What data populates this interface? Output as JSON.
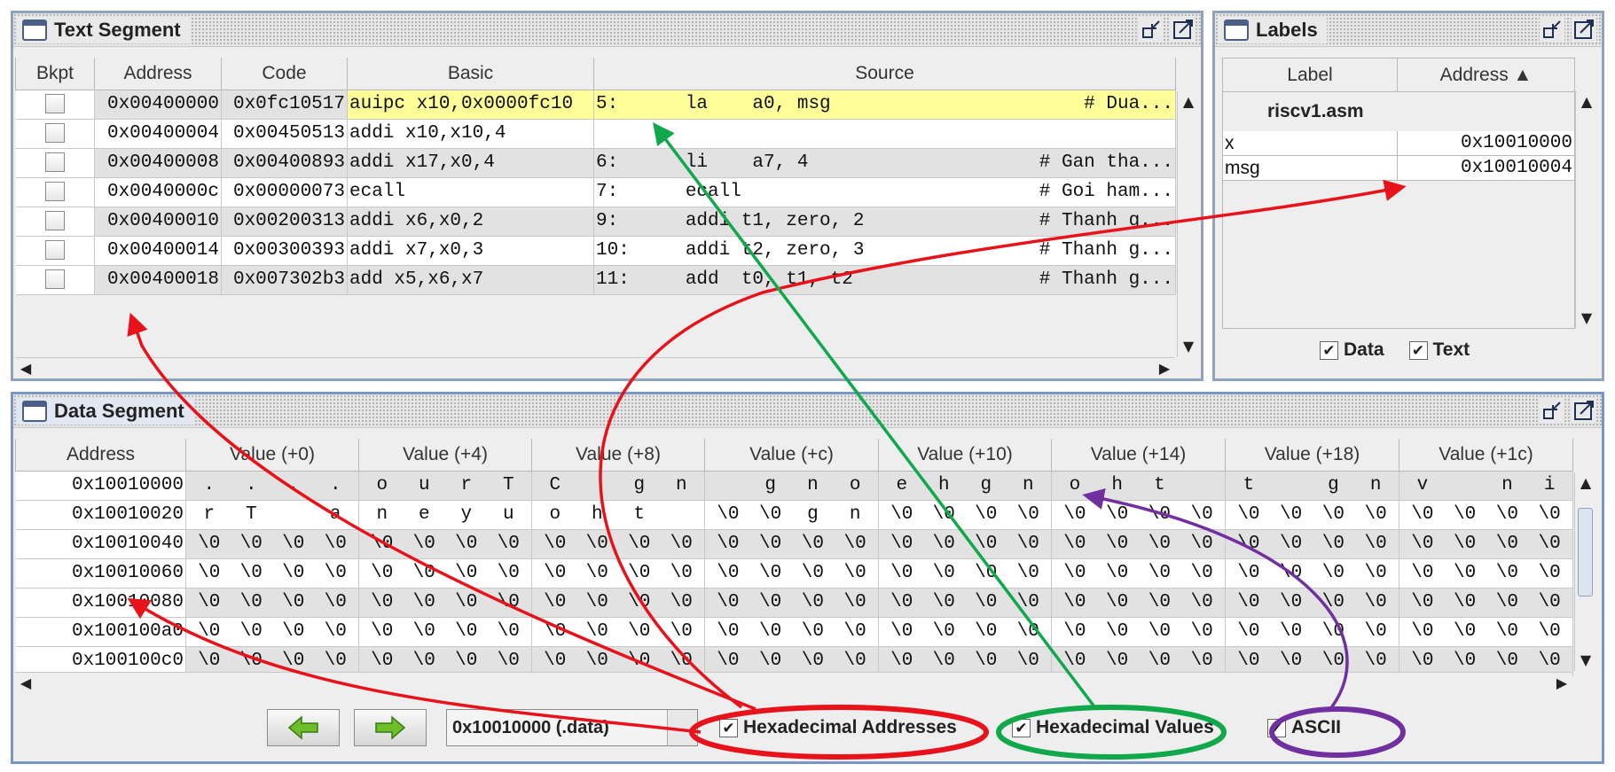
{
  "text_segment": {
    "title": "Text Segment",
    "columns": [
      "Bkpt",
      "Address",
      "Code",
      "Basic",
      "Source"
    ],
    "rows": [
      {
        "address": "0x00400000",
        "code": "0x0fc10517",
        "basic": "auipc x10,0x0000fc10",
        "source": "5:      la    a0, msg",
        "comment": "# Dua...",
        "highlight": true
      },
      {
        "address": "0x00400004",
        "code": "0x00450513",
        "basic": "addi x10,x10,4",
        "source": "",
        "comment": ""
      },
      {
        "address": "0x00400008",
        "code": "0x00400893",
        "basic": "addi x17,x0,4",
        "source": "6:      li    a7, 4",
        "comment": "# Gan tha..."
      },
      {
        "address": "0x0040000c",
        "code": "0x00000073",
        "basic": "ecall",
        "source": "7:      ecall",
        "comment": "# Goi ham..."
      },
      {
        "address": "0x00400010",
        "code": "0x00200313",
        "basic": "addi x6,x0,2",
        "source": "9:      addi t1, zero, 2",
        "comment": "# Thanh g..."
      },
      {
        "address": "0x00400014",
        "code": "0x00300393",
        "basic": "addi x7,x0,3",
        "source": "10:     addi t2, zero, 3",
        "comment": "# Thanh g..."
      },
      {
        "address": "0x00400018",
        "code": "0x007302b3",
        "basic": "add x5,x6,x7",
        "source": "11:     add  t0, t1, t2",
        "comment": "# Thanh g..."
      }
    ]
  },
  "labels": {
    "title": "Labels",
    "columns": [
      "Label",
      "Address ▲"
    ],
    "file": "riscv1.asm",
    "rows": [
      {
        "label": "x",
        "address": "0x10010000"
      },
      {
        "label": "msg",
        "address": "0x10010004"
      }
    ],
    "data_label": "Data",
    "text_label": "Text"
  },
  "data_segment": {
    "title": "Data Segment",
    "columns": [
      "Address",
      "Value (+0)",
      "Value (+4)",
      "Value (+8)",
      "Value (+c)",
      "Value (+10)",
      "Value (+14)",
      "Value (+18)",
      "Value (+1c)"
    ],
    "rows": [
      {
        "address": "0x10010000",
        "values": [
          [
            ".",
            ".",
            ".",
            "."
          ],
          [
            "o",
            "u",
            "r",
            "T"
          ],
          [
            "C",
            "",
            "g",
            "n"
          ],
          [
            "",
            "g",
            "n",
            "o"
          ],
          [
            "e",
            "h",
            "g",
            "n"
          ],
          [
            "o",
            "h",
            "t",
            ""
          ],
          [
            "t",
            "",
            "g",
            "n"
          ],
          [
            "v",
            "",
            "n",
            "i"
          ]
        ]
      },
      {
        "address": "0x10010020",
        "values": [
          [
            "r",
            "T",
            "",
            "a"
          ],
          [
            "n",
            "e",
            "y",
            "u"
          ],
          [
            "o",
            "h",
            "t",
            ""
          ],
          [
            "\\0",
            "\\0",
            "g",
            "n"
          ],
          [
            "\\0",
            "\\0",
            "\\0",
            "\\0"
          ],
          [
            "\\0",
            "\\0",
            "\\0",
            "\\0"
          ],
          [
            "\\0",
            "\\0",
            "\\0",
            "\\0"
          ],
          [
            "\\0",
            "\\0",
            "\\0",
            "\\0"
          ]
        ]
      },
      {
        "address": "0x10010040",
        "values": [
          [
            "\\0",
            "\\0",
            "\\0",
            "\\0"
          ],
          [
            "\\0",
            "\\0",
            "\\0",
            "\\0"
          ],
          [
            "\\0",
            "\\0",
            "\\0",
            "\\0"
          ],
          [
            "\\0",
            "\\0",
            "\\0",
            "\\0"
          ],
          [
            "\\0",
            "\\0",
            "\\0",
            "\\0"
          ],
          [
            "\\0",
            "\\0",
            "\\0",
            "\\0"
          ],
          [
            "\\0",
            "\\0",
            "\\0",
            "\\0"
          ],
          [
            "\\0",
            "\\0",
            "\\0",
            "\\0"
          ]
        ]
      },
      {
        "address": "0x10010060",
        "values": [
          [
            "\\0",
            "\\0",
            "\\0",
            "\\0"
          ],
          [
            "\\0",
            "\\0",
            "\\0",
            "\\0"
          ],
          [
            "\\0",
            "\\0",
            "\\0",
            "\\0"
          ],
          [
            "\\0",
            "\\0",
            "\\0",
            "\\0"
          ],
          [
            "\\0",
            "\\0",
            "\\0",
            "\\0"
          ],
          [
            "\\0",
            "\\0",
            "\\0",
            "\\0"
          ],
          [
            "\\0",
            "\\0",
            "\\0",
            "\\0"
          ],
          [
            "\\0",
            "\\0",
            "\\0",
            "\\0"
          ]
        ]
      },
      {
        "address": "0x10010080",
        "values": [
          [
            "\\0",
            "\\0",
            "\\0",
            "\\0"
          ],
          [
            "\\0",
            "\\0",
            "\\0",
            "\\0"
          ],
          [
            "\\0",
            "\\0",
            "\\0",
            "\\0"
          ],
          [
            "\\0",
            "\\0",
            "\\0",
            "\\0"
          ],
          [
            "\\0",
            "\\0",
            "\\0",
            "\\0"
          ],
          [
            "\\0",
            "\\0",
            "\\0",
            "\\0"
          ],
          [
            "\\0",
            "\\0",
            "\\0",
            "\\0"
          ],
          [
            "\\0",
            "\\0",
            "\\0",
            "\\0"
          ]
        ]
      },
      {
        "address": "0x100100a0",
        "values": [
          [
            "\\0",
            "\\0",
            "\\0",
            "\\0"
          ],
          [
            "\\0",
            "\\0",
            "\\0",
            "\\0"
          ],
          [
            "\\0",
            "\\0",
            "\\0",
            "\\0"
          ],
          [
            "\\0",
            "\\0",
            "\\0",
            "\\0"
          ],
          [
            "\\0",
            "\\0",
            "\\0",
            "\\0"
          ],
          [
            "\\0",
            "\\0",
            "\\0",
            "\\0"
          ],
          [
            "\\0",
            "\\0",
            "\\0",
            "\\0"
          ],
          [
            "\\0",
            "\\0",
            "\\0",
            "\\0"
          ]
        ]
      },
      {
        "address": "0x100100c0",
        "values": [
          [
            "\\0",
            "\\0",
            "\\0",
            "\\0"
          ],
          [
            "\\0",
            "\\0",
            "\\0",
            "\\0"
          ],
          [
            "\\0",
            "\\0",
            "\\0",
            "\\0"
          ],
          [
            "\\0",
            "\\0",
            "\\0",
            "\\0"
          ],
          [
            "\\0",
            "\\0",
            "\\0",
            "\\0"
          ],
          [
            "\\0",
            "\\0",
            "\\0",
            "\\0"
          ],
          [
            "\\0",
            "\\0",
            "\\0",
            "\\0"
          ],
          [
            "\\0",
            "\\0",
            "\\0",
            "\\0"
          ]
        ]
      }
    ],
    "address_combo": "0x10010000 (.data)",
    "hex_addresses_label": "Hexadecimal Addresses",
    "hex_values_label": "Hexadecimal Values",
    "ascii_label": "ASCII",
    "hex_addresses_checked": true,
    "hex_values_checked": true,
    "ascii_checked": true
  },
  "annotation_colors": {
    "addresses": "#e8121b",
    "values": "#10a84a",
    "ascii": "#7030a0"
  },
  "icons": {
    "window": "window-icon",
    "minimize": "minimize-icon",
    "maximize": "maximize-icon",
    "prev": "back-arrow-icon",
    "next": "forward-arrow-icon",
    "sort": "sort-ascending-icon"
  }
}
